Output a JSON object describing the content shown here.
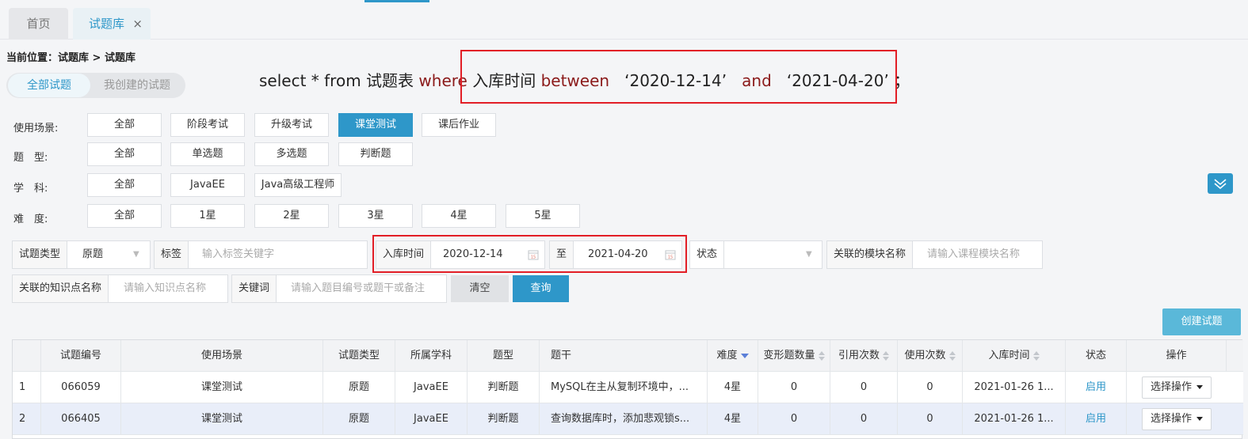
{
  "tabs": {
    "home": "首页",
    "active": "试题库",
    "close": "×"
  },
  "breadcrumb": "当前位置：试题库 > 试题库",
  "scope_toggle": {
    "all": "全部试题",
    "mine": "我创建的试题"
  },
  "sql": {
    "p1": "select * from 试题表 ",
    "kw_where": "where",
    "p2": " 入库时间 ",
    "kw_between": "between",
    "p3": "   ‘2020-12-14’   ",
    "kw_and": "and",
    "p4": "   ‘2021-04-20’ ；"
  },
  "filters": {
    "scene": {
      "label": "使用场景:",
      "options": [
        "全部",
        "阶段考试",
        "升级考试",
        "课堂测试",
        "课后作业"
      ],
      "selected": "课堂测试"
    },
    "type": {
      "label": "题　型:",
      "options": [
        "全部",
        "单选题",
        "多选题",
        "判断题"
      ]
    },
    "subject": {
      "label": "学　科:",
      "options": [
        "全部",
        "JavaEE",
        "Java高级工程师"
      ]
    },
    "difficulty": {
      "label": "难　度:",
      "options": [
        "全部",
        "1星",
        "2星",
        "3星",
        "4星",
        "5星"
      ]
    }
  },
  "search": {
    "question_type_label": "试题类型",
    "question_type_value": "原题",
    "tag_label": "标签",
    "tag_placeholder": "输入标签关键字",
    "date_label": "入库时间",
    "date_from": "2020-12-14",
    "date_to_label": "至",
    "date_to": "2021-04-20",
    "status_label": "状态",
    "module_label": "关联的模块名称",
    "module_placeholder": "请输入课程模块名称",
    "knowledge_label": "关联的知识点名称",
    "knowledge_placeholder": "请输入知识点名称",
    "keyword_label": "关键词",
    "keyword_placeholder": "请输入题目编号或题干或备注",
    "clear_label": "清空",
    "query_label": "查询",
    "create_label": "创建试题"
  },
  "table": {
    "headers": [
      "试题编号",
      "使用场景",
      "试题类型",
      "所属学科",
      "题型",
      "题干",
      "难度",
      "变形题数量",
      "引用次数",
      "使用次数",
      "入库时间",
      "状态",
      "操作"
    ],
    "rows": [
      [
        "1",
        "066059",
        "课堂测试",
        "原题",
        "JavaEE",
        "判断题",
        "MySQL在主从复制环境中，...",
        "4星",
        "0",
        "0",
        "0",
        "2021-01-26 1...",
        "启用",
        "选择操作"
      ],
      [
        "2",
        "066405",
        "课堂测试",
        "原题",
        "JavaEE",
        "判断题",
        "查询数据库时，添加悲观锁s...",
        "4星",
        "0",
        "0",
        "0",
        "2021-01-26 1...",
        "启用",
        "选择操作"
      ]
    ]
  },
  "colors": {
    "accent": "#2e97c9",
    "highlight_box": "#e21e26",
    "sql_keyword": "#8b1a1a"
  }
}
